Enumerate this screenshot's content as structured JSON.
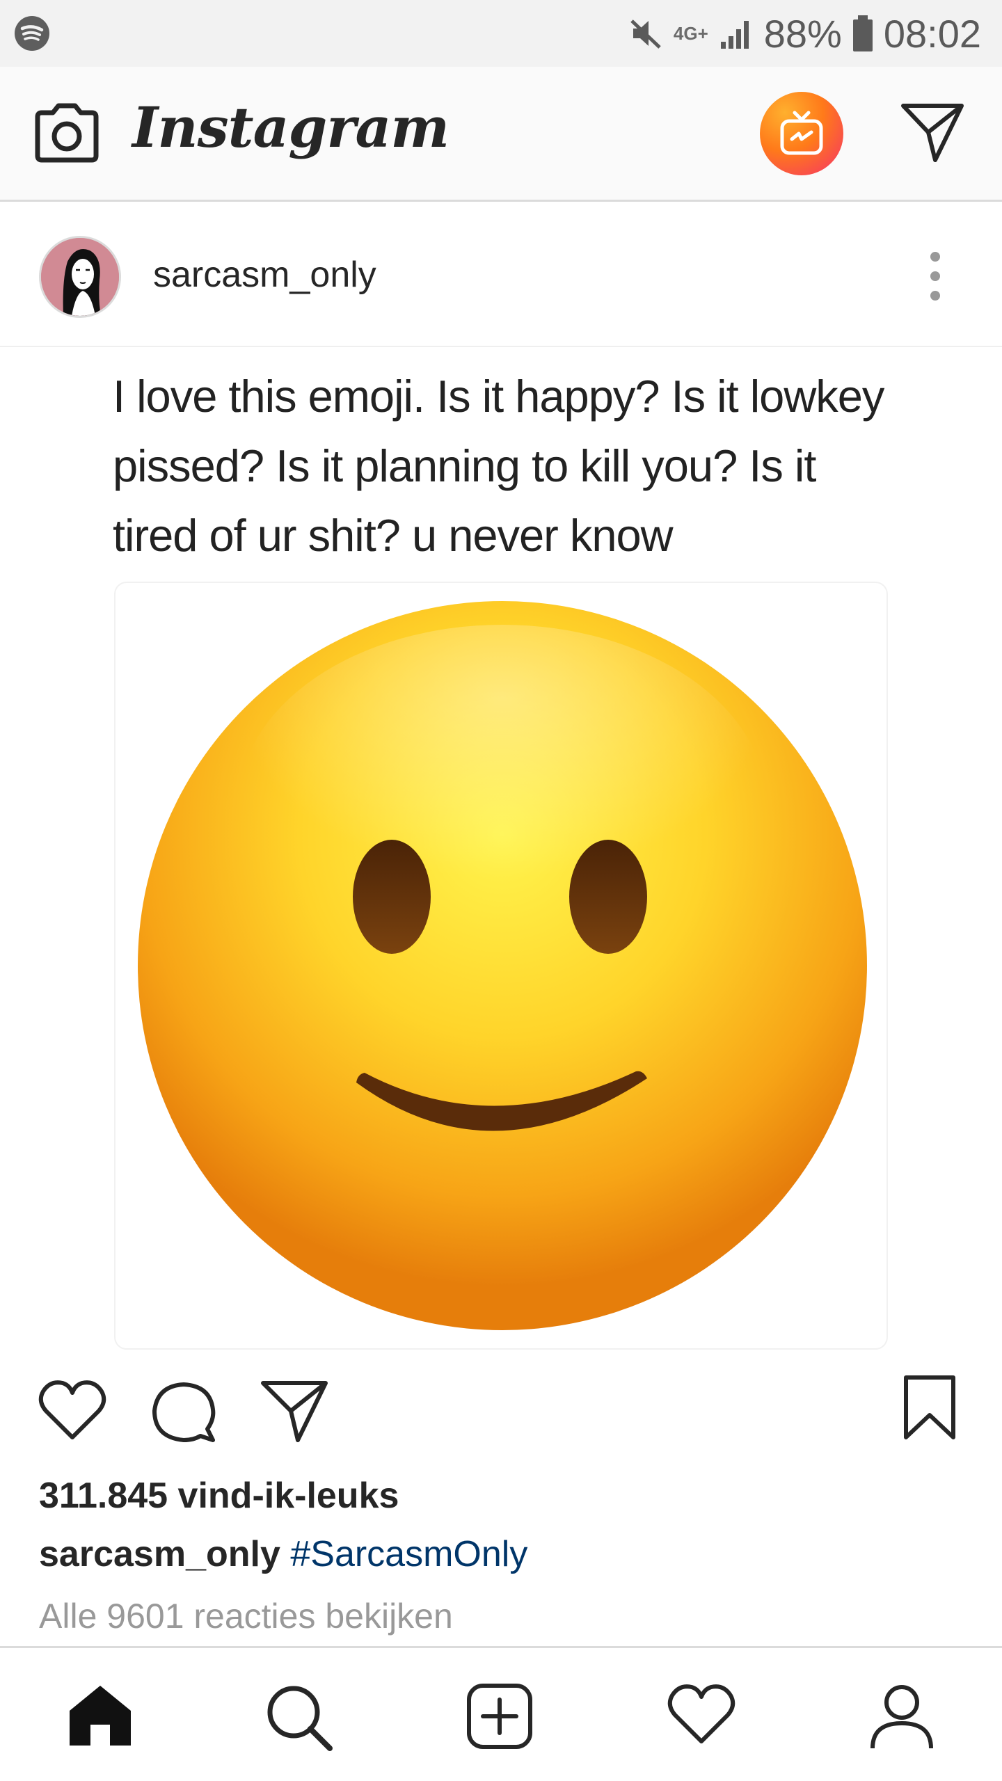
{
  "status_bar": {
    "network": "4G+",
    "battery": "88%",
    "time": "08:02",
    "icons": [
      "spotify-icon",
      "mute-icon",
      "signal-icon",
      "battery-icon"
    ]
  },
  "top_bar": {
    "logo_text": "Instagram",
    "icons": [
      "camera-icon",
      "igtv-icon",
      "direct-message-icon"
    ]
  },
  "post": {
    "username": "sarcasm_only",
    "tweet_text": "I love this emoji. Is it happy? Is it lowkey pissed? Is it planning to kill you? Is it tired of ur shit? u never know",
    "likes": "311.845 vind-ik-leuks",
    "caption_user": "sarcasm_only",
    "caption_hashtag": "#SarcasmOnly",
    "view_comments": "Alle 9601 reacties bekijken",
    "action_icons": [
      "heart-icon",
      "comment-icon",
      "share-icon",
      "bookmark-icon"
    ]
  },
  "bottom_nav": {
    "items": [
      "home-icon",
      "search-icon",
      "add-post-icon",
      "activity-heart-icon",
      "profile-icon"
    ]
  },
  "colors": {
    "hashtag": "#003569",
    "secondary_text": "#999999",
    "igtv_gradient_start": "#ffb02e",
    "igtv_gradient_end": "#f5306b"
  }
}
